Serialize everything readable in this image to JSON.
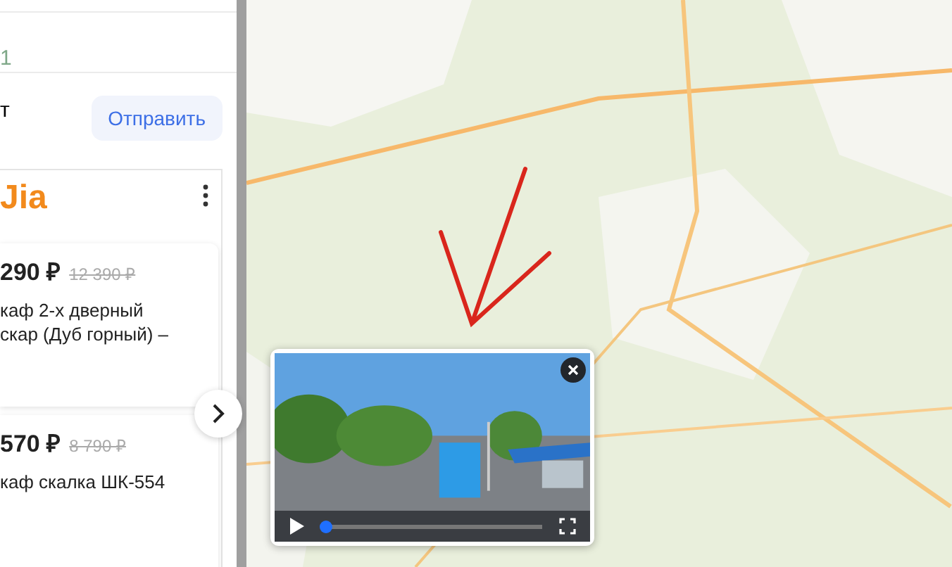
{
  "sidebar": {
    "top_value": "1",
    "message_label": "т",
    "send_button": "Отправить"
  },
  "ad_card": {
    "logo": "Jia",
    "products": [
      {
        "price": "290 ₽",
        "old_price": "12 390 ₽",
        "title": "каф 2-х дверный\nскар (Дуб горный) –"
      },
      {
        "price": "570 ₽",
        "old_price": "8 790 ₽",
        "title": "каф скалка ШК-554"
      }
    ]
  },
  "video": {
    "level": 0.02
  }
}
